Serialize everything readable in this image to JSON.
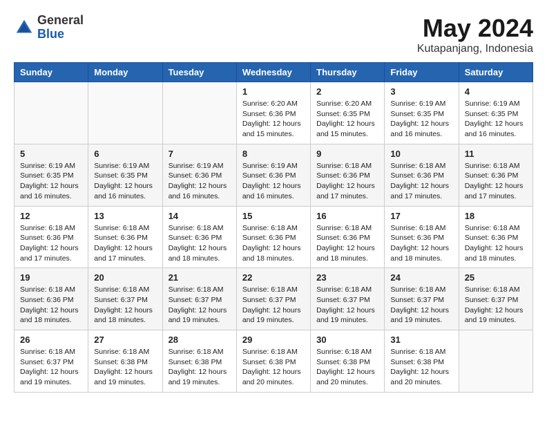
{
  "header": {
    "logo_general": "General",
    "logo_blue": "Blue",
    "month_title": "May 2024",
    "location": "Kutapanjang, Indonesia"
  },
  "weekdays": [
    "Sunday",
    "Monday",
    "Tuesday",
    "Wednesday",
    "Thursday",
    "Friday",
    "Saturday"
  ],
  "weeks": [
    [
      {
        "day": "",
        "info": ""
      },
      {
        "day": "",
        "info": ""
      },
      {
        "day": "",
        "info": ""
      },
      {
        "day": "1",
        "info": "Sunrise: 6:20 AM\nSunset: 6:36 PM\nDaylight: 12 hours\nand 15 minutes."
      },
      {
        "day": "2",
        "info": "Sunrise: 6:20 AM\nSunset: 6:35 PM\nDaylight: 12 hours\nand 15 minutes."
      },
      {
        "day": "3",
        "info": "Sunrise: 6:19 AM\nSunset: 6:35 PM\nDaylight: 12 hours\nand 16 minutes."
      },
      {
        "day": "4",
        "info": "Sunrise: 6:19 AM\nSunset: 6:35 PM\nDaylight: 12 hours\nand 16 minutes."
      }
    ],
    [
      {
        "day": "5",
        "info": "Sunrise: 6:19 AM\nSunset: 6:35 PM\nDaylight: 12 hours\nand 16 minutes."
      },
      {
        "day": "6",
        "info": "Sunrise: 6:19 AM\nSunset: 6:35 PM\nDaylight: 12 hours\nand 16 minutes."
      },
      {
        "day": "7",
        "info": "Sunrise: 6:19 AM\nSunset: 6:36 PM\nDaylight: 12 hours\nand 16 minutes."
      },
      {
        "day": "8",
        "info": "Sunrise: 6:19 AM\nSunset: 6:36 PM\nDaylight: 12 hours\nand 16 minutes."
      },
      {
        "day": "9",
        "info": "Sunrise: 6:18 AM\nSunset: 6:36 PM\nDaylight: 12 hours\nand 17 minutes."
      },
      {
        "day": "10",
        "info": "Sunrise: 6:18 AM\nSunset: 6:36 PM\nDaylight: 12 hours\nand 17 minutes."
      },
      {
        "day": "11",
        "info": "Sunrise: 6:18 AM\nSunset: 6:36 PM\nDaylight: 12 hours\nand 17 minutes."
      }
    ],
    [
      {
        "day": "12",
        "info": "Sunrise: 6:18 AM\nSunset: 6:36 PM\nDaylight: 12 hours\nand 17 minutes."
      },
      {
        "day": "13",
        "info": "Sunrise: 6:18 AM\nSunset: 6:36 PM\nDaylight: 12 hours\nand 17 minutes."
      },
      {
        "day": "14",
        "info": "Sunrise: 6:18 AM\nSunset: 6:36 PM\nDaylight: 12 hours\nand 18 minutes."
      },
      {
        "day": "15",
        "info": "Sunrise: 6:18 AM\nSunset: 6:36 PM\nDaylight: 12 hours\nand 18 minutes."
      },
      {
        "day": "16",
        "info": "Sunrise: 6:18 AM\nSunset: 6:36 PM\nDaylight: 12 hours\nand 18 minutes."
      },
      {
        "day": "17",
        "info": "Sunrise: 6:18 AM\nSunset: 6:36 PM\nDaylight: 12 hours\nand 18 minutes."
      },
      {
        "day": "18",
        "info": "Sunrise: 6:18 AM\nSunset: 6:36 PM\nDaylight: 12 hours\nand 18 minutes."
      }
    ],
    [
      {
        "day": "19",
        "info": "Sunrise: 6:18 AM\nSunset: 6:36 PM\nDaylight: 12 hours\nand 18 minutes."
      },
      {
        "day": "20",
        "info": "Sunrise: 6:18 AM\nSunset: 6:37 PM\nDaylight: 12 hours\nand 18 minutes."
      },
      {
        "day": "21",
        "info": "Sunrise: 6:18 AM\nSunset: 6:37 PM\nDaylight: 12 hours\nand 19 minutes."
      },
      {
        "day": "22",
        "info": "Sunrise: 6:18 AM\nSunset: 6:37 PM\nDaylight: 12 hours\nand 19 minutes."
      },
      {
        "day": "23",
        "info": "Sunrise: 6:18 AM\nSunset: 6:37 PM\nDaylight: 12 hours\nand 19 minutes."
      },
      {
        "day": "24",
        "info": "Sunrise: 6:18 AM\nSunset: 6:37 PM\nDaylight: 12 hours\nand 19 minutes."
      },
      {
        "day": "25",
        "info": "Sunrise: 6:18 AM\nSunset: 6:37 PM\nDaylight: 12 hours\nand 19 minutes."
      }
    ],
    [
      {
        "day": "26",
        "info": "Sunrise: 6:18 AM\nSunset: 6:37 PM\nDaylight: 12 hours\nand 19 minutes."
      },
      {
        "day": "27",
        "info": "Sunrise: 6:18 AM\nSunset: 6:38 PM\nDaylight: 12 hours\nand 19 minutes."
      },
      {
        "day": "28",
        "info": "Sunrise: 6:18 AM\nSunset: 6:38 PM\nDaylight: 12 hours\nand 19 minutes."
      },
      {
        "day": "29",
        "info": "Sunrise: 6:18 AM\nSunset: 6:38 PM\nDaylight: 12 hours\nand 20 minutes."
      },
      {
        "day": "30",
        "info": "Sunrise: 6:18 AM\nSunset: 6:38 PM\nDaylight: 12 hours\nand 20 minutes."
      },
      {
        "day": "31",
        "info": "Sunrise: 6:18 AM\nSunset: 6:38 PM\nDaylight: 12 hours\nand 20 minutes."
      },
      {
        "day": "",
        "info": ""
      }
    ]
  ]
}
